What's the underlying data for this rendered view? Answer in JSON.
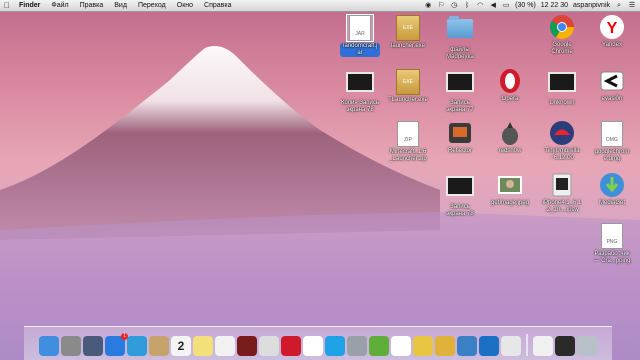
{
  "menubar": {
    "apple_icon": "apple-icon",
    "app": "Finder",
    "items": [
      "Файл",
      "Правка",
      "Вид",
      "Переход",
      "Окно",
      "Справка"
    ],
    "battery": "(30 %)",
    "clock": "12 22 30",
    "user": "aspanpivnik"
  },
  "desktop_icons": [
    {
      "label": "randomcraft.j\nar",
      "kind": "document",
      "tag": "JAR",
      "selected": true
    },
    {
      "label": "launcher.exe",
      "kind": "exe",
      "tag": "EXE"
    },
    {
      "label": "файлы\nMadpeyka",
      "kind": "folder"
    },
    {
      "label": "Google\nChrome",
      "kind": "chrome"
    },
    {
      "label": "Yandex",
      "kind": "yandex"
    },
    {
      "label": "Копия Запись\nэкрана 78",
      "kind": "video"
    },
    {
      "label": "TLauncher.exe",
      "kind": "exe",
      "tag": "EXE"
    },
    {
      "label": "Запись\nэкрана 77",
      "kind": "video"
    },
    {
      "label": "Opera",
      "kind": "opera"
    },
    {
      "label": "Unknown",
      "kind": "video"
    },
    {
      "label": "evasi0n",
      "kind": "evasion"
    },
    {
      "label": "Minecraft_1.6\n_Launcher.zip",
      "kind": "zip",
      "tag": "ZIP"
    },
    {
      "label": "Reflector",
      "kind": "reflector"
    },
    {
      "label": "redsn0w",
      "kind": "pineapple"
    },
    {
      "label": "TinyUmbrella\n- 6.12.00",
      "kind": "umbrella"
    },
    {
      "label": "googlechrom\ne.dmg",
      "kind": "document",
      "tag": "DMG"
    },
    {
      "label": "Запись\nэкрана 78",
      "kind": "video"
    },
    {
      "label": "getImage.jpeg",
      "kind": "photo"
    },
    {
      "label": "iPhone4,1_6.1\n.2_10....ipsw",
      "kind": "ipsw"
    },
    {
      "label": "MediaGet",
      "kind": "mediaget"
    },
    {
      "label": "Разработчик\n— Cra...pping",
      "kind": "document",
      "tag": "PNG"
    }
  ],
  "dock": [
    {
      "name": "finder",
      "color": "#3f8ee0"
    },
    {
      "name": "launchpad",
      "color": "#8a8a8a"
    },
    {
      "name": "mission-control",
      "color": "#4a5a7a"
    },
    {
      "name": "app-store",
      "color": "#2a7be0",
      "badge": "1"
    },
    {
      "name": "safari",
      "color": "#2f9bd8"
    },
    {
      "name": "contacts",
      "color": "#c7a36c"
    },
    {
      "name": "calendar",
      "color": "#f4f4f4",
      "text": "2"
    },
    {
      "name": "notes",
      "color": "#f3e07a"
    },
    {
      "name": "reminders",
      "color": "#f2f2f2"
    },
    {
      "name": "photo-booth",
      "color": "#7a1b1b"
    },
    {
      "name": "preview",
      "color": "#dddddd"
    },
    {
      "name": "opera",
      "color": "#d0192b"
    },
    {
      "name": "yandex",
      "color": "#ffffff"
    },
    {
      "name": "skype",
      "color": "#1fa1e6"
    },
    {
      "name": "mail",
      "color": "#9aa0a8"
    },
    {
      "name": "utorrent",
      "color": "#5fae3a"
    },
    {
      "name": "xcode",
      "color": "#ffffff"
    },
    {
      "name": "stuffit",
      "color": "#e8c642"
    },
    {
      "name": "chrome",
      "color": "#e0b23a"
    },
    {
      "name": "image-capture",
      "color": "#3b7fc4"
    },
    {
      "name": "teamviewer",
      "color": "#1b6fc4"
    },
    {
      "name": "system-info",
      "color": "#e7e7e7"
    },
    {
      "name": "screenshot-tool",
      "color": "#f0f0f0"
    },
    {
      "name": "downloads",
      "color": "#2a2a2a"
    },
    {
      "name": "trash",
      "color": "#b8c0c8"
    }
  ]
}
